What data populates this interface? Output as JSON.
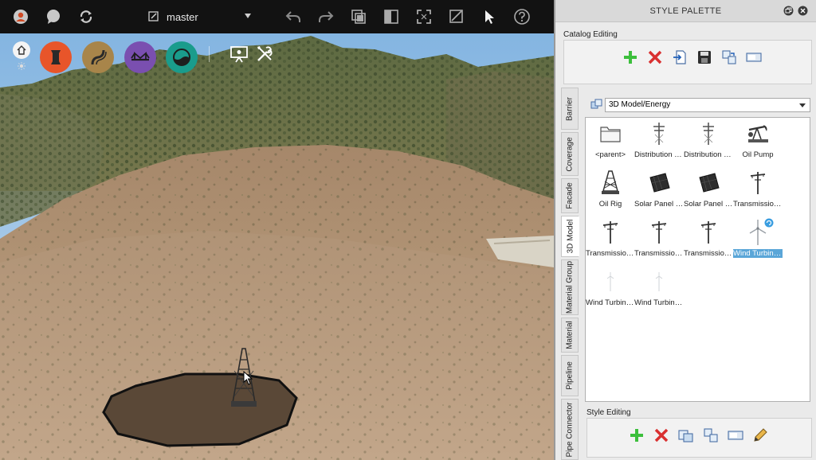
{
  "toolbar": {
    "branch": "master"
  },
  "panel": {
    "title": "STYLE PALETTE",
    "catalog_editing_label": "Catalog Editing",
    "style_editing_label": "Style Editing",
    "path": "3D Model/Energy",
    "tabs": [
      "Barrier",
      "Coverage",
      "Facade",
      "3D Model",
      "Material Group",
      "Material",
      "Pipeline",
      "Pipe Connector"
    ],
    "active_tab": "3D Model",
    "items": [
      {
        "label": "<parent>",
        "icon": "folder-icon"
      },
      {
        "label": "Distribution P...",
        "icon": "distribution-pole-icon"
      },
      {
        "label": "Distribution P...",
        "icon": "distribution-pole-icon"
      },
      {
        "label": "Oil Pump",
        "icon": "oil-pump-icon"
      },
      {
        "label": "Oil Rig",
        "icon": "oil-rig-icon"
      },
      {
        "label": "Solar Panel - ...",
        "icon": "solar-panel-icon"
      },
      {
        "label": "Solar Panel - ...",
        "icon": "solar-panel-icon"
      },
      {
        "label": "Transmission ...",
        "icon": "transmission-tower-icon"
      },
      {
        "label": "Transmission ...",
        "icon": "transmission-tower-icon"
      },
      {
        "label": "Transmission ...",
        "icon": "transmission-tower-icon"
      },
      {
        "label": "Transmission ...",
        "icon": "transmission-tower-icon"
      },
      {
        "label": "Wind Turbine ...",
        "icon": "wind-turbine-icon",
        "selected": true
      },
      {
        "label": "Wind Turbine ...",
        "icon": "wind-turbine-icon"
      },
      {
        "label": "Wind Turbine ...",
        "icon": "wind-turbine-icon"
      }
    ]
  },
  "colors": {
    "road_tool": "#e8552a",
    "terrain_tool": "#a8854a",
    "bridge_tool": "#7a4fb0",
    "water_tool": "#1a9c8c",
    "selection": "#5aa6d8"
  }
}
